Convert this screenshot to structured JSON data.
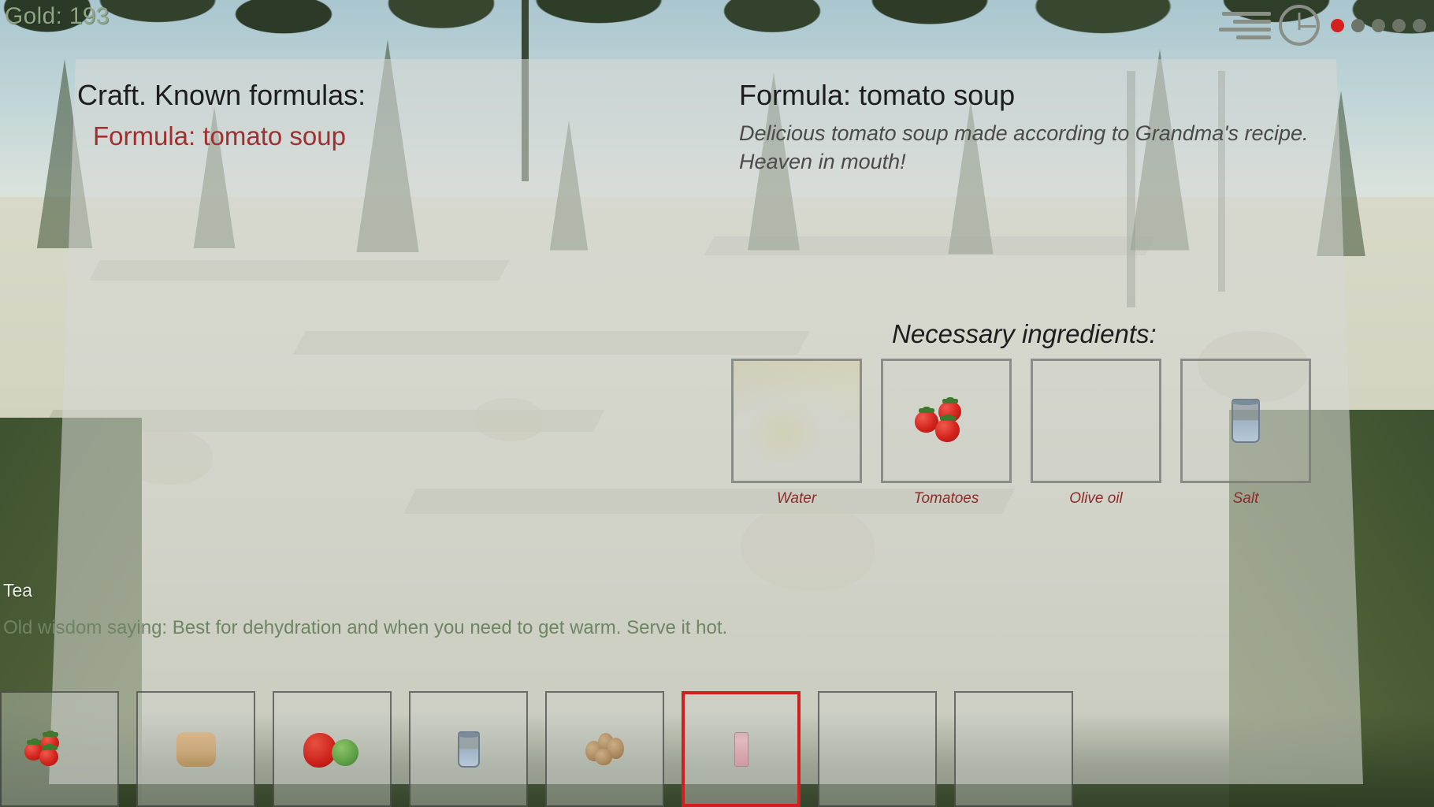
{
  "hud": {
    "gold_label": "Gold: 193",
    "gold_color": "#8fa882",
    "compass_icon": "compass-dial-icon",
    "speed_icon": "speed-lines-icon",
    "status_dots": [
      {
        "name": "dot-1",
        "active": true,
        "color": "#d61f1f"
      },
      {
        "name": "dot-2",
        "active": false,
        "color": "#6d7569"
      },
      {
        "name": "dot-3",
        "active": false,
        "color": "#6d7569"
      },
      {
        "name": "dot-4",
        "active": false,
        "color": "#6d7569"
      },
      {
        "name": "dot-5",
        "active": false,
        "color": "#6d7569"
      }
    ]
  },
  "craft_panel": {
    "known_formulas_header": "Craft. Known formulas:",
    "formulas": [
      {
        "label": "Formula: tomato soup",
        "selected": true,
        "color": "#9e3030"
      }
    ],
    "detail": {
      "title": "Formula: tomato soup",
      "description": "Delicious tomato soup made according to Grandma's recipe. Heaven in mouth!",
      "ingredients_header": "Necessary ingredients:",
      "ingredients": [
        {
          "label": "Water",
          "icon": "crystals-icon",
          "filled": false
        },
        {
          "label": "Tomatoes",
          "icon": "tomatoes-icon",
          "filled": true
        },
        {
          "label": "Olive oil",
          "icon": "empty-icon",
          "filled": false
        },
        {
          "label": "Salt",
          "icon": "glass-icon",
          "filled": true
        }
      ],
      "label_color": "#8d2b2b"
    }
  },
  "tooltip": {
    "title": "Tea",
    "text": "Old wisdom saying: Best for dehydration and when you need to get warm. Serve it hot.",
    "text_color": "#6e8464"
  },
  "hotbar": {
    "selected_index": 5,
    "selected_color": "#d01f1f",
    "slots": [
      {
        "index": 0,
        "icon": "tomatoes-icon",
        "empty": false
      },
      {
        "index": 1,
        "icon": "bread-icon",
        "empty": false
      },
      {
        "index": 2,
        "icon": "apple-lime-icon",
        "empty": false
      },
      {
        "index": 3,
        "icon": "water-glass-icon",
        "empty": false
      },
      {
        "index": 4,
        "icon": "potatoes-icon",
        "empty": false
      },
      {
        "index": 5,
        "icon": "tea-flask-icon",
        "empty": false
      },
      {
        "index": 6,
        "icon": "empty-icon",
        "empty": true
      },
      {
        "index": 7,
        "icon": "empty-icon",
        "empty": true
      }
    ]
  }
}
